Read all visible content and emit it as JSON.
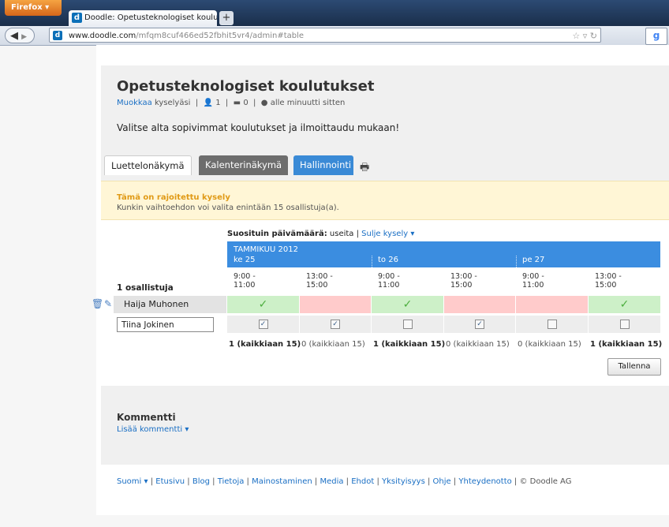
{
  "browser": {
    "menu_button": "Firefox",
    "tab_title": "Doodle: Opetusteknologiset koulutukset",
    "new_tab": "+",
    "url_domain": "www.doodle.com",
    "url_path": "/mfqm8cuf466ed52fbhit5vr4/admin#table"
  },
  "poll": {
    "title": "Opetusteknologiset koulutukset",
    "edit_link": "Muokkaa",
    "edit_suffix": "kyselyäsi",
    "participants_count": "1",
    "comments_count": "0",
    "updated": "alle minuutti sitten",
    "description": "Valitse alta sopivimmat koulutukset ja ilmoittaudu mukaan!"
  },
  "views": {
    "list": "Luettelonäkymä",
    "calendar": "Kalenterinäkymä",
    "admin": "Hallinnointi"
  },
  "notice": {
    "title": "Tämä on rajoitettu kysely",
    "text": "Kunkin vaihtoehdon voi valita enintään 15 osallistuja(a)."
  },
  "popular": {
    "label": "Suosituin päivämäärä:",
    "value": "useita",
    "close_link": "Sulje kysely"
  },
  "table": {
    "month": "TAMMIKUU 2012",
    "days": [
      "ke 25",
      "to 26",
      "pe 27"
    ],
    "slots": [
      "9:00 -\n11:00",
      "13:00 -\n15:00",
      "9:00 -\n11:00",
      "13:00 -\n15:00",
      "9:00 -\n11:00",
      "13:00 -\n15:00"
    ],
    "participants_label": "1 osallistuja",
    "participant_name": "Haija Muhonen",
    "participant_answers": [
      true,
      false,
      true,
      false,
      false,
      true
    ],
    "input_name": "Tiina Jokinen",
    "input_checks": [
      true,
      true,
      false,
      true,
      false,
      false
    ],
    "totals": [
      "1 (kaikkiaan 15)",
      "0 (kaikkiaan 15)",
      "1 (kaikkiaan 15)",
      "0 (kaikkiaan 15)",
      "0 (kaikkiaan 15)",
      "1 (kaikkiaan 15)"
    ],
    "save_button": "Tallenna"
  },
  "comments": {
    "heading": "Kommentti",
    "add_link": "Lisää kommentti"
  },
  "footer": {
    "language": "Suomi",
    "links": [
      "Etusivu",
      "Blog",
      "Tietoja",
      "Mainostaminen",
      "Media",
      "Ehdot",
      "Yksityisyys",
      "Ohje",
      "Yhteydenotto"
    ],
    "copyright": "© Doodle AG"
  },
  "colors": {
    "header_blue": "#3b8de0",
    "yes_green": "#cdf0c8",
    "no_red": "#ffcbcb",
    "notice_bg": "#fff6d6"
  }
}
